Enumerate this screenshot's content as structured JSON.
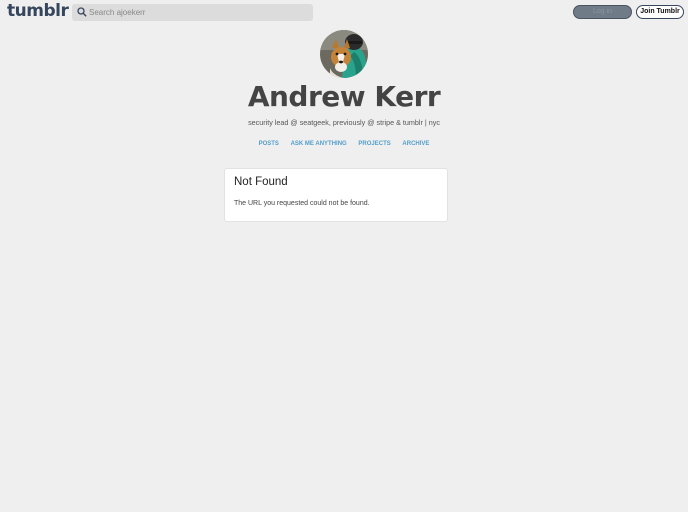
{
  "header": {
    "logo": "tumblr",
    "search_placeholder": "Search ajoekerr",
    "login_label": "Log in",
    "join_label": "Join Tumblr"
  },
  "blog": {
    "title": "Andrew Kerr",
    "description": "security lead @ seatgeek, previously @ stripe & tumblr | nyc",
    "nav": [
      "POSTS",
      "ASK ME ANYTHING",
      "PROJECTS",
      "ARCHIVE"
    ]
  },
  "error": {
    "heading": "Not Found",
    "message": "The URL you requested could not be found."
  },
  "colors": {
    "background": "#efefef",
    "link": "#529ecc",
    "brand": "#36465d"
  }
}
